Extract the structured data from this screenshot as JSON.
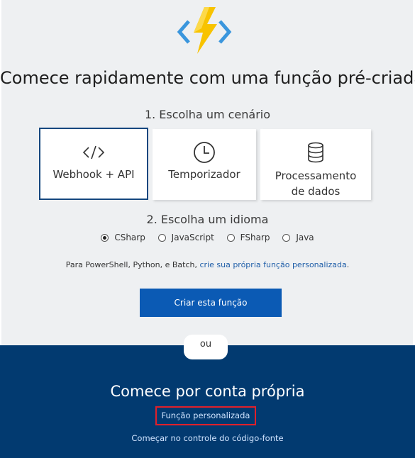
{
  "header": {
    "logo_icon": "azure-functions-lightning-icon"
  },
  "title": "Comece rapidamente com uma função pré-criada",
  "step1": {
    "label": "1. Escolha um cenário"
  },
  "scenarios": [
    {
      "label": "Webhook + API",
      "icon": "code-brackets-icon",
      "selected": true
    },
    {
      "label": "Temporizador",
      "icon": "clock-icon",
      "selected": false
    },
    {
      "label_line1": "Processamento",
      "label_line2": "de dados",
      "icon": "database-icon",
      "selected": false
    }
  ],
  "step2": {
    "label": "2. Escolha um idioma"
  },
  "languages": [
    {
      "label": "CSharp",
      "selected": true
    },
    {
      "label": "JavaScript",
      "selected": false
    },
    {
      "label": "FSharp",
      "selected": false
    },
    {
      "label": "Java",
      "selected": false
    }
  ],
  "note": {
    "text": "Para PowerShell, Python, e Batch, ",
    "link": "crie sua própria função personalizada",
    "suffix": "."
  },
  "create_button": "Criar esta função",
  "divider": "ou",
  "own": {
    "title": "Comece por conta própria",
    "custom_link": "Função personalizada",
    "source_link": "Começar no controle do código-fonte"
  },
  "colors": {
    "accent": "#0b5ab4",
    "dark_band": "#023a70",
    "highlight": "#e0202a",
    "logo_yellow": "#f8c300",
    "logo_blue": "#3a96dd"
  }
}
